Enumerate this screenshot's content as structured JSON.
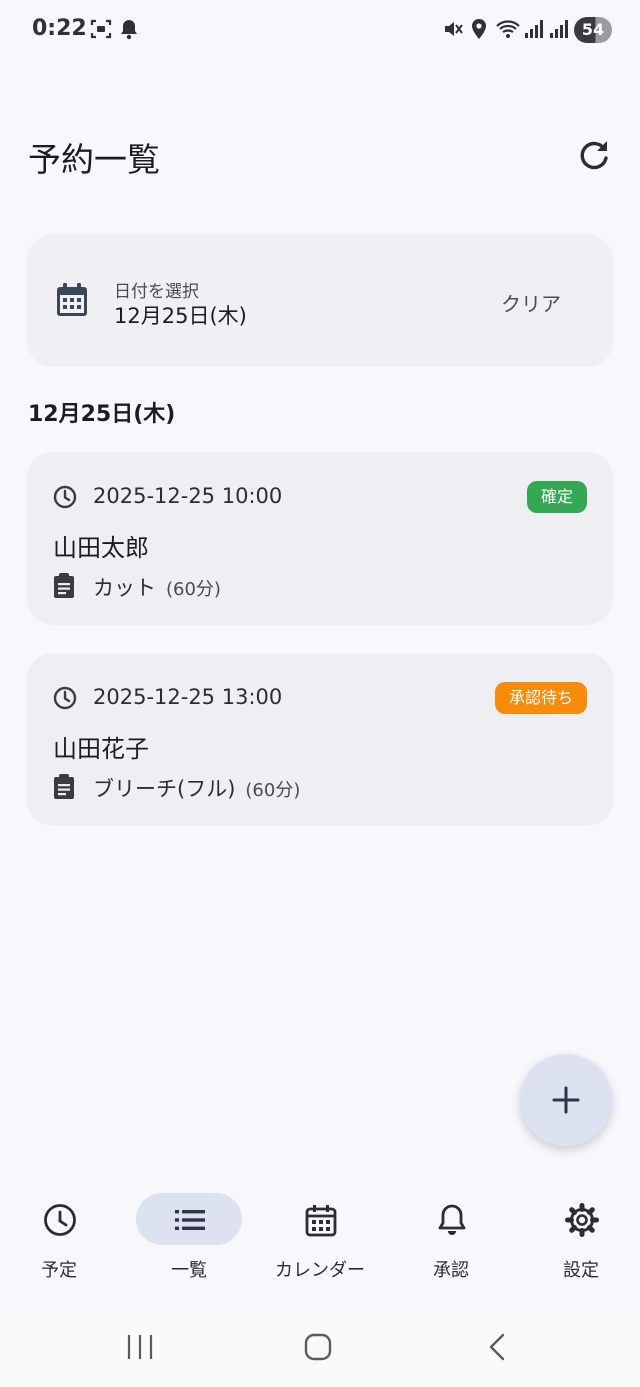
{
  "status_bar": {
    "time": "0:22",
    "battery": "54"
  },
  "header": {
    "title": "予約一覧",
    "refresh_icon": "refresh-icon"
  },
  "date_picker": {
    "caption": "日付を選択",
    "value": "12月25日(木)",
    "clear_label": "クリア",
    "icon": "calendar-icon"
  },
  "section": {
    "date_heading": "12月25日(木)"
  },
  "reservations": [
    {
      "time": "2025-12-25 10:00",
      "status": "確定",
      "status_color": "#34a853",
      "customer": "山田太郎",
      "service": "カット",
      "duration": "(60分)"
    },
    {
      "time": "2025-12-25 13:00",
      "status": "承認待ち",
      "status_color": "#f78b0c",
      "customer": "山田花子",
      "service": "ブリーチ(フル)",
      "duration": "(60分)"
    }
  ],
  "fab": {
    "icon": "plus-icon"
  },
  "bottom_nav": {
    "active": "一覧",
    "items": [
      {
        "label": "予定",
        "icon": "clock-icon"
      },
      {
        "label": "一覧",
        "icon": "list-icon"
      },
      {
        "label": "カレンダー",
        "icon": "calendar-icon"
      },
      {
        "label": "承認",
        "icon": "bell-icon"
      },
      {
        "label": "設定",
        "icon": "gear-icon"
      }
    ]
  },
  "accent_color": "#dde2f0"
}
